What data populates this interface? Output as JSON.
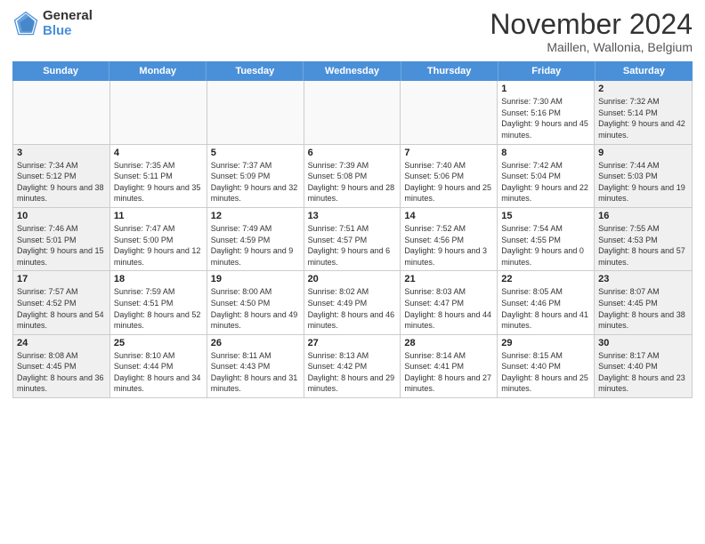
{
  "logo": {
    "general": "General",
    "blue": "Blue"
  },
  "title": "November 2024",
  "location": "Maillen, Wallonia, Belgium",
  "days_header": [
    "Sunday",
    "Monday",
    "Tuesday",
    "Wednesday",
    "Thursday",
    "Friday",
    "Saturday"
  ],
  "weeks": [
    [
      {
        "day": "",
        "info": ""
      },
      {
        "day": "",
        "info": ""
      },
      {
        "day": "",
        "info": ""
      },
      {
        "day": "",
        "info": ""
      },
      {
        "day": "",
        "info": ""
      },
      {
        "day": "1",
        "info": "Sunrise: 7:30 AM\nSunset: 5:16 PM\nDaylight: 9 hours and 45 minutes."
      },
      {
        "day": "2",
        "info": "Sunrise: 7:32 AM\nSunset: 5:14 PM\nDaylight: 9 hours and 42 minutes."
      }
    ],
    [
      {
        "day": "3",
        "info": "Sunrise: 7:34 AM\nSunset: 5:12 PM\nDaylight: 9 hours and 38 minutes."
      },
      {
        "day": "4",
        "info": "Sunrise: 7:35 AM\nSunset: 5:11 PM\nDaylight: 9 hours and 35 minutes."
      },
      {
        "day": "5",
        "info": "Sunrise: 7:37 AM\nSunset: 5:09 PM\nDaylight: 9 hours and 32 minutes."
      },
      {
        "day": "6",
        "info": "Sunrise: 7:39 AM\nSunset: 5:08 PM\nDaylight: 9 hours and 28 minutes."
      },
      {
        "day": "7",
        "info": "Sunrise: 7:40 AM\nSunset: 5:06 PM\nDaylight: 9 hours and 25 minutes."
      },
      {
        "day": "8",
        "info": "Sunrise: 7:42 AM\nSunset: 5:04 PM\nDaylight: 9 hours and 22 minutes."
      },
      {
        "day": "9",
        "info": "Sunrise: 7:44 AM\nSunset: 5:03 PM\nDaylight: 9 hours and 19 minutes."
      }
    ],
    [
      {
        "day": "10",
        "info": "Sunrise: 7:46 AM\nSunset: 5:01 PM\nDaylight: 9 hours and 15 minutes."
      },
      {
        "day": "11",
        "info": "Sunrise: 7:47 AM\nSunset: 5:00 PM\nDaylight: 9 hours and 12 minutes."
      },
      {
        "day": "12",
        "info": "Sunrise: 7:49 AM\nSunset: 4:59 PM\nDaylight: 9 hours and 9 minutes."
      },
      {
        "day": "13",
        "info": "Sunrise: 7:51 AM\nSunset: 4:57 PM\nDaylight: 9 hours and 6 minutes."
      },
      {
        "day": "14",
        "info": "Sunrise: 7:52 AM\nSunset: 4:56 PM\nDaylight: 9 hours and 3 minutes."
      },
      {
        "day": "15",
        "info": "Sunrise: 7:54 AM\nSunset: 4:55 PM\nDaylight: 9 hours and 0 minutes."
      },
      {
        "day": "16",
        "info": "Sunrise: 7:55 AM\nSunset: 4:53 PM\nDaylight: 8 hours and 57 minutes."
      }
    ],
    [
      {
        "day": "17",
        "info": "Sunrise: 7:57 AM\nSunset: 4:52 PM\nDaylight: 8 hours and 54 minutes."
      },
      {
        "day": "18",
        "info": "Sunrise: 7:59 AM\nSunset: 4:51 PM\nDaylight: 8 hours and 52 minutes."
      },
      {
        "day": "19",
        "info": "Sunrise: 8:00 AM\nSunset: 4:50 PM\nDaylight: 8 hours and 49 minutes."
      },
      {
        "day": "20",
        "info": "Sunrise: 8:02 AM\nSunset: 4:49 PM\nDaylight: 8 hours and 46 minutes."
      },
      {
        "day": "21",
        "info": "Sunrise: 8:03 AM\nSunset: 4:47 PM\nDaylight: 8 hours and 44 minutes."
      },
      {
        "day": "22",
        "info": "Sunrise: 8:05 AM\nSunset: 4:46 PM\nDaylight: 8 hours and 41 minutes."
      },
      {
        "day": "23",
        "info": "Sunrise: 8:07 AM\nSunset: 4:45 PM\nDaylight: 8 hours and 38 minutes."
      }
    ],
    [
      {
        "day": "24",
        "info": "Sunrise: 8:08 AM\nSunset: 4:45 PM\nDaylight: 8 hours and 36 minutes."
      },
      {
        "day": "25",
        "info": "Sunrise: 8:10 AM\nSunset: 4:44 PM\nDaylight: 8 hours and 34 minutes."
      },
      {
        "day": "26",
        "info": "Sunrise: 8:11 AM\nSunset: 4:43 PM\nDaylight: 8 hours and 31 minutes."
      },
      {
        "day": "27",
        "info": "Sunrise: 8:13 AM\nSunset: 4:42 PM\nDaylight: 8 hours and 29 minutes."
      },
      {
        "day": "28",
        "info": "Sunrise: 8:14 AM\nSunset: 4:41 PM\nDaylight: 8 hours and 27 minutes."
      },
      {
        "day": "29",
        "info": "Sunrise: 8:15 AM\nSunset: 4:40 PM\nDaylight: 8 hours and 25 minutes."
      },
      {
        "day": "30",
        "info": "Sunrise: 8:17 AM\nSunset: 4:40 PM\nDaylight: 8 hours and 23 minutes."
      }
    ]
  ]
}
